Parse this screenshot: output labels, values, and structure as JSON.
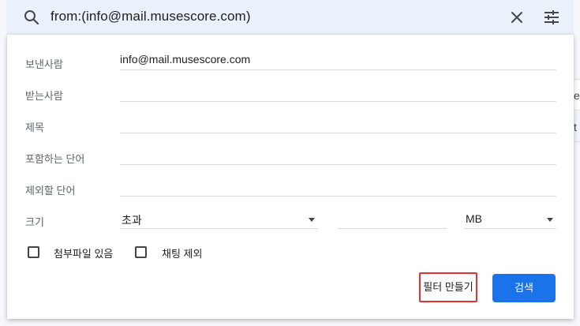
{
  "search": {
    "query": "from:(info@mail.musescore.com)"
  },
  "background": {
    "peek_char_1": "e",
    "peek_char_2": "t"
  },
  "form": {
    "from": {
      "label": "보낸사람",
      "value": "info@mail.musescore.com"
    },
    "to": {
      "label": "받는사람",
      "value": ""
    },
    "subject": {
      "label": "제목",
      "value": ""
    },
    "has_words": {
      "label": "포함하는 단어",
      "value": ""
    },
    "doesnt_have": {
      "label": "제외할 단어",
      "value": ""
    },
    "size": {
      "label": "크기",
      "operator": "초과",
      "value": "",
      "unit": "MB"
    },
    "has_attachment": {
      "label": "첨부파일 있음",
      "checked": false
    },
    "exclude_chats": {
      "label": "채팅 제외",
      "checked": false
    },
    "create_filter_label": "필터 만들기",
    "search_label": "검색"
  },
  "colors": {
    "primary": "#1a73e8",
    "highlight_box": "#e0322f",
    "search_bar_bg": "#eaf1fb"
  }
}
